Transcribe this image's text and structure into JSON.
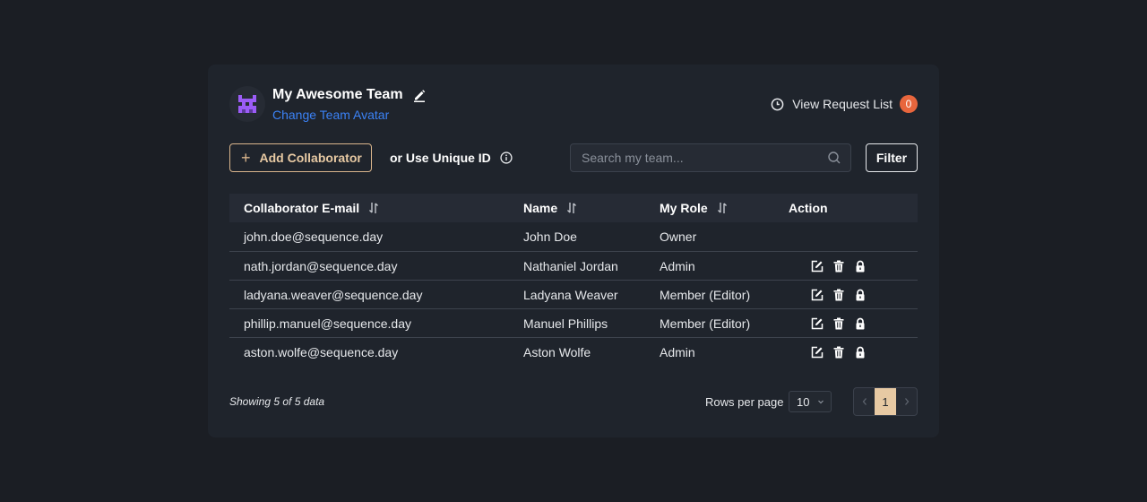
{
  "header": {
    "team_name": "My Awesome Team",
    "change_avatar_label": "Change Team Avatar",
    "request_list_label": "View Request List",
    "request_count": "0"
  },
  "toolbar": {
    "add_collaborator_label": "Add Collaborator",
    "unique_id_label": "or Use Unique ID",
    "search_placeholder": "Search my team...",
    "search_value": "",
    "filter_label": "Filter"
  },
  "table": {
    "columns": [
      {
        "label": "Collaborator E-mail",
        "sortable": true
      },
      {
        "label": "Name",
        "sortable": true
      },
      {
        "label": "My Role",
        "sortable": true
      },
      {
        "label": "Action",
        "sortable": false
      }
    ],
    "rows": [
      {
        "email": "john.doe@sequence.day",
        "name": "John Doe",
        "role": "Owner",
        "actions": []
      },
      {
        "email": "nath.jordan@sequence.day",
        "name": "Nathaniel Jordan",
        "role": "Admin",
        "actions": [
          "edit-icon",
          "trash-icon",
          "lock-icon"
        ]
      },
      {
        "email": "ladyana.weaver@sequence.day",
        "name": "Ladyana Weaver",
        "role": "Member (Editor)",
        "actions": [
          "edit-icon",
          "trash-icon",
          "lock-icon"
        ]
      },
      {
        "email": "phillip.manuel@sequence.day",
        "name": "Manuel Phillips",
        "role": "Member (Editor)",
        "actions": [
          "edit-icon",
          "trash-icon",
          "lock-icon"
        ]
      },
      {
        "email": "aston.wolfe@sequence.day",
        "name": "Aston Wolfe",
        "role": "Admin",
        "actions": [
          "edit-icon",
          "trash-icon",
          "lock-icon"
        ]
      }
    ]
  },
  "footer": {
    "showing_text": "Showing 5 of 5 data",
    "rows_per_page_label": "Rows per page",
    "rows_per_page_value": "10",
    "current_page": "1"
  },
  "colors": {
    "accent": "#e7c9a3",
    "link": "#3b82f6",
    "badge": "#e8663d",
    "avatar": "#9b5cf6"
  }
}
